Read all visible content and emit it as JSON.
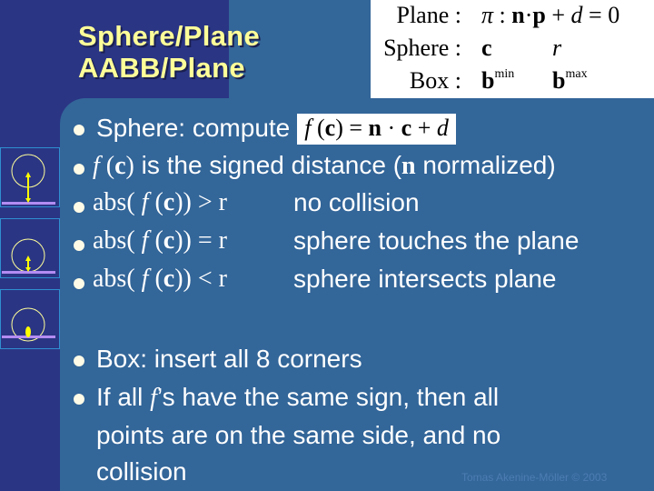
{
  "slide": {
    "title_lines": [
      "Sphere/Plane",
      "AABB/Plane"
    ],
    "definitions": [
      {
        "label": "Plane :",
        "value_html": "π : n·p + d = 0"
      },
      {
        "label": "Sphere :",
        "value_c": "c",
        "value_r": "r"
      },
      {
        "label": "Box :",
        "value_min": "b",
        "sup_min": "min",
        "value_max": "b",
        "sup_max": "max"
      }
    ],
    "bullets": [
      {
        "text": "Sphere: compute",
        "formula": "f (c) = n · c + d"
      },
      {
        "math": "f (c)",
        "text": " is the signed distance (",
        "bold_math": "n",
        "text2": " normalized)"
      },
      {
        "math": "abs( f (c)) > r",
        "text": "no collision"
      },
      {
        "math": "abs( f (c)) = r",
        "text": "sphere touches the plane"
      },
      {
        "math": "abs( f (c)) < r",
        "text": "sphere intersects plane"
      },
      {
        "text": "Box: insert all 8 corners"
      },
      {
        "text_a": "If all ",
        "math": "f",
        "text_b": "’s have the same sign, then all",
        "cont": [
          "points are on the same side, and no",
          "collision"
        ]
      }
    ],
    "footer": "Tomas Akenine-Möller © 2003"
  },
  "diagrams": [
    {
      "name": "no-collision",
      "distance_vs_radius": "greater"
    },
    {
      "name": "touches",
      "distance_vs_radius": "equal"
    },
    {
      "name": "intersects",
      "distance_vs_radius": "less"
    }
  ],
  "colors": {
    "background": "#336699",
    "dark_band": "#2a3584",
    "title": "#ffff99",
    "plane": "#b38cf2",
    "sphere": "#ffff99",
    "arrow": "#ffff00"
  }
}
